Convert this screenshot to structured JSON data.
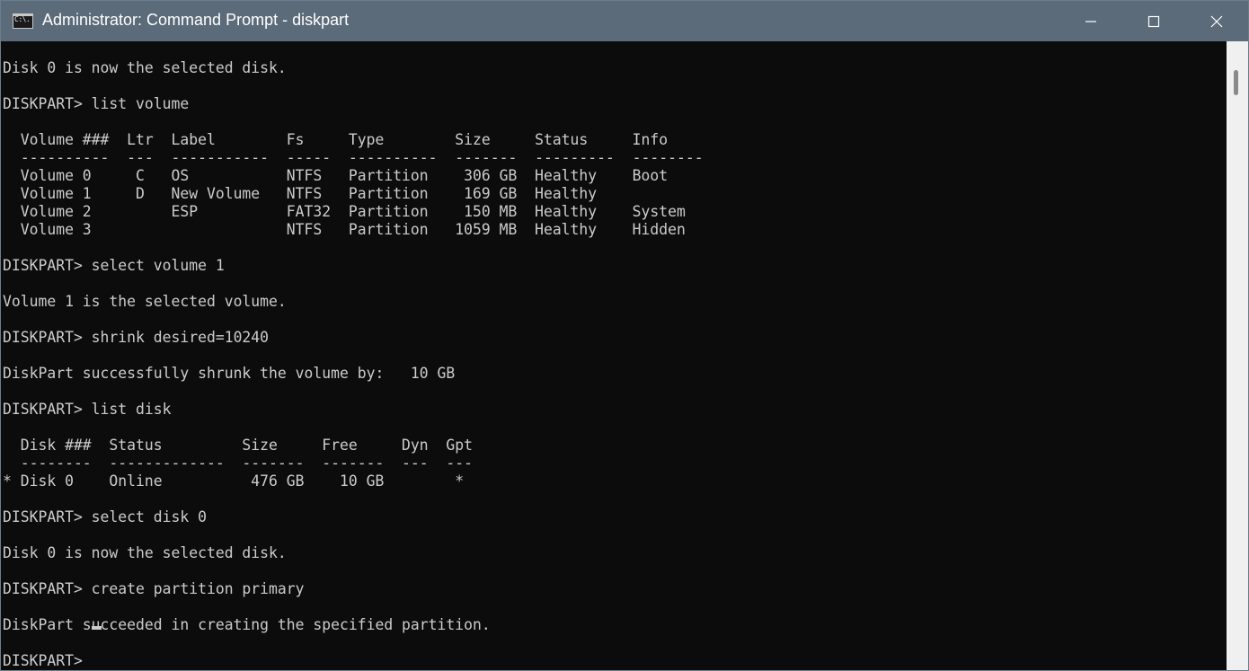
{
  "window": {
    "title": "Administrator: Command Prompt - diskpart",
    "icon_label": "C:\\."
  },
  "controls": {
    "minimize": "minimize-icon",
    "maximize": "maximize-icon",
    "close": "close-icon"
  },
  "console": {
    "lines": [
      "",
      "Disk 0 is now the selected disk.",
      "",
      "DISKPART> list volume",
      "",
      "  Volume ###  Ltr  Label        Fs     Type        Size     Status     Info",
      "  ----------  ---  -----------  -----  ----------  -------  ---------  --------",
      "  Volume 0     C   OS           NTFS   Partition    306 GB  Healthy    Boot",
      "  Volume 1     D   New Volume   NTFS   Partition    169 GB  Healthy",
      "  Volume 2         ESP          FAT32  Partition    150 MB  Healthy    System",
      "  Volume 3                      NTFS   Partition   1059 MB  Healthy    Hidden",
      "",
      "DISKPART> select volume 1",
      "",
      "Volume 1 is the selected volume.",
      "",
      "DISKPART> shrink desired=10240",
      "",
      "DiskPart successfully shrunk the volume by:   10 GB",
      "",
      "DISKPART> list disk",
      "",
      "  Disk ###  Status         Size     Free     Dyn  Gpt",
      "  --------  -------------  -------  -------  ---  ---",
      "* Disk 0    Online          476 GB    10 GB        *",
      "",
      "DISKPART> select disk 0",
      "",
      "Disk 0 is now the selected disk.",
      "",
      "DISKPART> create partition primary",
      "",
      "DiskPart succeeded in creating the specified partition.",
      "",
      "DISKPART> "
    ]
  }
}
